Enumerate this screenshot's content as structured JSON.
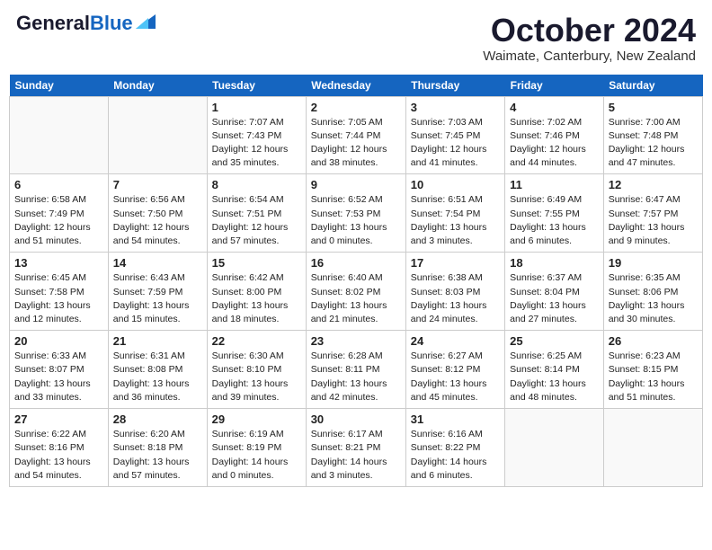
{
  "header": {
    "logo_general": "General",
    "logo_blue": "Blue",
    "month_title": "October 2024",
    "location": "Waimate, Canterbury, New Zealand"
  },
  "days_of_week": [
    "Sunday",
    "Monday",
    "Tuesday",
    "Wednesday",
    "Thursday",
    "Friday",
    "Saturday"
  ],
  "weeks": [
    [
      {
        "day": "",
        "content": ""
      },
      {
        "day": "",
        "content": ""
      },
      {
        "day": "1",
        "content": "Sunrise: 7:07 AM\nSunset: 7:43 PM\nDaylight: 12 hours and 35 minutes."
      },
      {
        "day": "2",
        "content": "Sunrise: 7:05 AM\nSunset: 7:44 PM\nDaylight: 12 hours and 38 minutes."
      },
      {
        "day": "3",
        "content": "Sunrise: 7:03 AM\nSunset: 7:45 PM\nDaylight: 12 hours and 41 minutes."
      },
      {
        "day": "4",
        "content": "Sunrise: 7:02 AM\nSunset: 7:46 PM\nDaylight: 12 hours and 44 minutes."
      },
      {
        "day": "5",
        "content": "Sunrise: 7:00 AM\nSunset: 7:48 PM\nDaylight: 12 hours and 47 minutes."
      }
    ],
    [
      {
        "day": "6",
        "content": "Sunrise: 6:58 AM\nSunset: 7:49 PM\nDaylight: 12 hours and 51 minutes."
      },
      {
        "day": "7",
        "content": "Sunrise: 6:56 AM\nSunset: 7:50 PM\nDaylight: 12 hours and 54 minutes."
      },
      {
        "day": "8",
        "content": "Sunrise: 6:54 AM\nSunset: 7:51 PM\nDaylight: 12 hours and 57 minutes."
      },
      {
        "day": "9",
        "content": "Sunrise: 6:52 AM\nSunset: 7:53 PM\nDaylight: 13 hours and 0 minutes."
      },
      {
        "day": "10",
        "content": "Sunrise: 6:51 AM\nSunset: 7:54 PM\nDaylight: 13 hours and 3 minutes."
      },
      {
        "day": "11",
        "content": "Sunrise: 6:49 AM\nSunset: 7:55 PM\nDaylight: 13 hours and 6 minutes."
      },
      {
        "day": "12",
        "content": "Sunrise: 6:47 AM\nSunset: 7:57 PM\nDaylight: 13 hours and 9 minutes."
      }
    ],
    [
      {
        "day": "13",
        "content": "Sunrise: 6:45 AM\nSunset: 7:58 PM\nDaylight: 13 hours and 12 minutes."
      },
      {
        "day": "14",
        "content": "Sunrise: 6:43 AM\nSunset: 7:59 PM\nDaylight: 13 hours and 15 minutes."
      },
      {
        "day": "15",
        "content": "Sunrise: 6:42 AM\nSunset: 8:00 PM\nDaylight: 13 hours and 18 minutes."
      },
      {
        "day": "16",
        "content": "Sunrise: 6:40 AM\nSunset: 8:02 PM\nDaylight: 13 hours and 21 minutes."
      },
      {
        "day": "17",
        "content": "Sunrise: 6:38 AM\nSunset: 8:03 PM\nDaylight: 13 hours and 24 minutes."
      },
      {
        "day": "18",
        "content": "Sunrise: 6:37 AM\nSunset: 8:04 PM\nDaylight: 13 hours and 27 minutes."
      },
      {
        "day": "19",
        "content": "Sunrise: 6:35 AM\nSunset: 8:06 PM\nDaylight: 13 hours and 30 minutes."
      }
    ],
    [
      {
        "day": "20",
        "content": "Sunrise: 6:33 AM\nSunset: 8:07 PM\nDaylight: 13 hours and 33 minutes."
      },
      {
        "day": "21",
        "content": "Sunrise: 6:31 AM\nSunset: 8:08 PM\nDaylight: 13 hours and 36 minutes."
      },
      {
        "day": "22",
        "content": "Sunrise: 6:30 AM\nSunset: 8:10 PM\nDaylight: 13 hours and 39 minutes."
      },
      {
        "day": "23",
        "content": "Sunrise: 6:28 AM\nSunset: 8:11 PM\nDaylight: 13 hours and 42 minutes."
      },
      {
        "day": "24",
        "content": "Sunrise: 6:27 AM\nSunset: 8:12 PM\nDaylight: 13 hours and 45 minutes."
      },
      {
        "day": "25",
        "content": "Sunrise: 6:25 AM\nSunset: 8:14 PM\nDaylight: 13 hours and 48 minutes."
      },
      {
        "day": "26",
        "content": "Sunrise: 6:23 AM\nSunset: 8:15 PM\nDaylight: 13 hours and 51 minutes."
      }
    ],
    [
      {
        "day": "27",
        "content": "Sunrise: 6:22 AM\nSunset: 8:16 PM\nDaylight: 13 hours and 54 minutes."
      },
      {
        "day": "28",
        "content": "Sunrise: 6:20 AM\nSunset: 8:18 PM\nDaylight: 13 hours and 57 minutes."
      },
      {
        "day": "29",
        "content": "Sunrise: 6:19 AM\nSunset: 8:19 PM\nDaylight: 14 hours and 0 minutes."
      },
      {
        "day": "30",
        "content": "Sunrise: 6:17 AM\nSunset: 8:21 PM\nDaylight: 14 hours and 3 minutes."
      },
      {
        "day": "31",
        "content": "Sunrise: 6:16 AM\nSunset: 8:22 PM\nDaylight: 14 hours and 6 minutes."
      },
      {
        "day": "",
        "content": ""
      },
      {
        "day": "",
        "content": ""
      }
    ]
  ]
}
